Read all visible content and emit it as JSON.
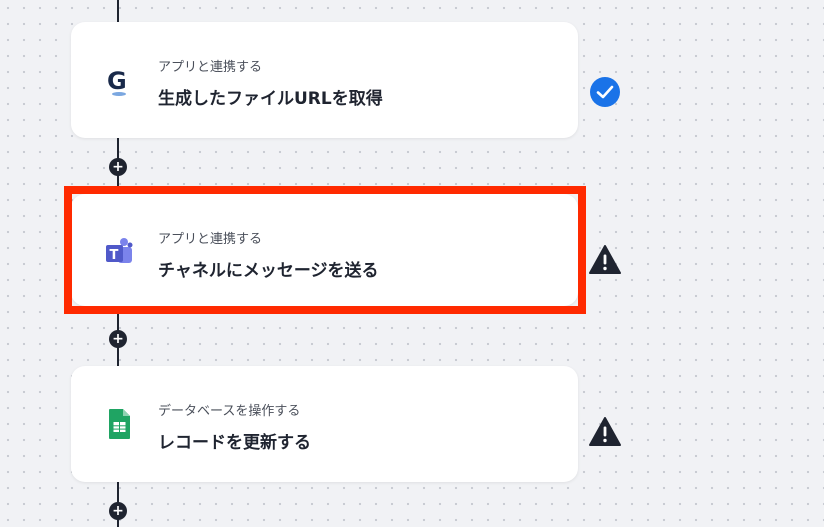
{
  "steps": [
    {
      "subtitle": "アプリと連携する",
      "title": "生成したファイルURLを取得",
      "icon": "google-docs-logo-icon",
      "status": "check-circle-icon"
    },
    {
      "subtitle": "アプリと連携する",
      "title": "チャネルにメッセージを送る",
      "icon": "microsoft-teams-logo-icon",
      "status": "warning-triangle-icon"
    },
    {
      "subtitle": "データベースを操作する",
      "title": "レコードを更新する",
      "icon": "google-sheets-logo-icon",
      "status": "warning-triangle-icon"
    }
  ],
  "add_step_glyph": "+",
  "colors": {
    "check": "#1a73e8",
    "warning": "#1f2430",
    "highlight": "#ff2a00",
    "teams": "#5059c9",
    "sheets": "#1fa463"
  }
}
